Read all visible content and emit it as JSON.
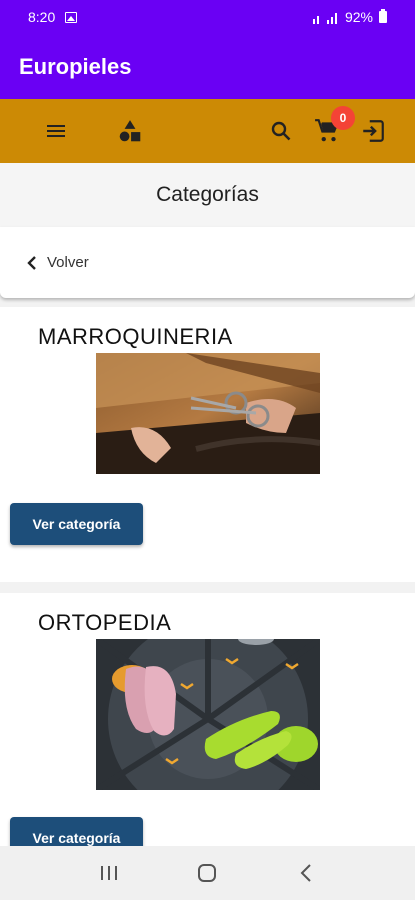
{
  "status_bar": {
    "time": "8:20",
    "battery": "92%"
  },
  "app_bar": {
    "title": "Europieles"
  },
  "toolbar": {
    "cart_count": "0",
    "icons": [
      "menu-icon",
      "categories-shapes-icon",
      "search-icon",
      "cart-icon",
      "logout-icon"
    ]
  },
  "page": {
    "title": "Categorías",
    "back_label": "Volver"
  },
  "categories": [
    {
      "name": "MARROQUINERIA",
      "button_label": "Ver categoría"
    },
    {
      "name": "ORTOPEDIA",
      "button_label": "Ver categoría"
    }
  ],
  "colors": {
    "app_bar": "#6a00f4",
    "toolbar": "#cc8a05",
    "button": "#1d4e7a",
    "badge": "#f44336"
  }
}
